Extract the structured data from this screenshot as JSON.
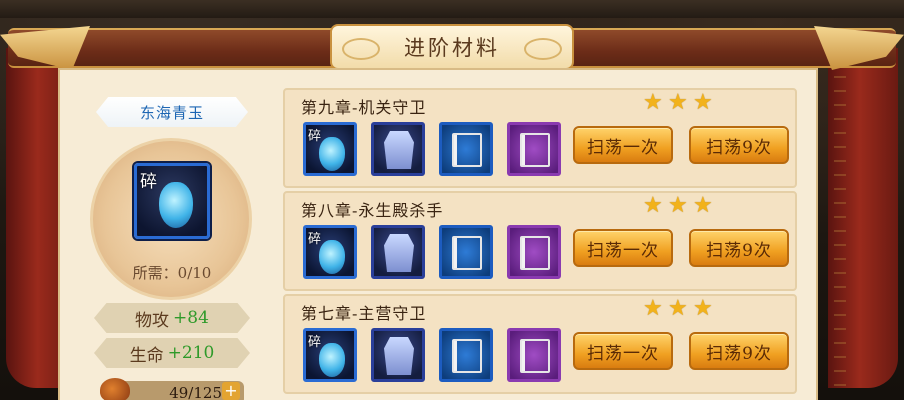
{
  "top_strip_text": "",
  "title": "进阶材料",
  "item": {
    "name": "东海青玉",
    "shard_tag": "碎",
    "required_label": "所需：0/10"
  },
  "stats": [
    {
      "label": "物攻",
      "value": "+84"
    },
    {
      "label": "生命",
      "value": "+210"
    }
  ],
  "resource": {
    "value": "49/125",
    "plus": "+"
  },
  "chapters": [
    {
      "title": "第九章-机关守卫",
      "stars": 3,
      "shard_tag": "碎",
      "drops": [
        "jade-icon",
        "armor-icon",
        "blue-book-icon",
        "purple-book-icon"
      ],
      "sweep_once": "扫荡一次",
      "sweep_nine": "扫荡9次"
    },
    {
      "title": "第八章-永生殿杀手",
      "stars": 3,
      "shard_tag": "碎",
      "drops": [
        "jade-icon",
        "bracers-icon",
        "blue-book-icon",
        "purple-book-icon"
      ],
      "sweep_once": "扫荡一次",
      "sweep_nine": "扫荡9次"
    },
    {
      "title": "第七章-主营守卫",
      "stars": 3,
      "shard_tag": "碎",
      "drops": [
        "jade-icon",
        "bracers-icon",
        "blue-book-icon",
        "purple-book-icon"
      ],
      "sweep_once": "扫荡一次",
      "sweep_nine": "扫荡9次"
    }
  ],
  "colors": {
    "button_gold": "#f0a021",
    "stat_green": "#2f9a2a",
    "name_blue": "#1d66b3",
    "star": "#f2b21b"
  }
}
